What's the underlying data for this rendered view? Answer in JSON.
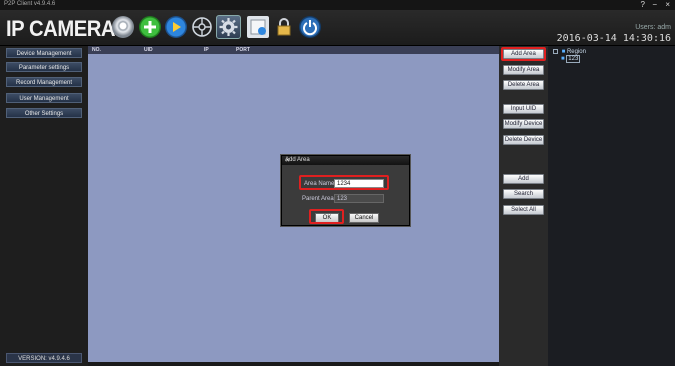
{
  "window": {
    "app_title": "P2P Client v4.9.4.6",
    "help": "?",
    "minimize": "−",
    "close": "×"
  },
  "header": {
    "logo": "IP CAMERA",
    "user_label": "Users: adm",
    "datetime": "2016-03-14 14:30:16",
    "toolbar": [
      {
        "name": "camera-view-icon",
        "color": "#dfe4ea"
      },
      {
        "name": "add-device-icon",
        "color": "#3fbf3f"
      },
      {
        "name": "playback-icon",
        "color": "#2e86de"
      },
      {
        "name": "ptz-icon",
        "color": "#cfd6de"
      },
      {
        "name": "settings-gear-icon",
        "color": "#d7dde6"
      },
      {
        "name": "log-icon",
        "color": "#cfd6de"
      },
      {
        "name": "lock-icon",
        "color": "#e6b84a"
      },
      {
        "name": "power-icon",
        "color": "#5aa0e6"
      }
    ]
  },
  "sidebar": {
    "items": [
      "Device Management",
      "Parameter settings",
      "Record Management",
      "User Management",
      "Other Settings"
    ],
    "version": "VERSION: v4.9.4.6"
  },
  "table": {
    "columns": [
      "NO.",
      "UID",
      "IP",
      "PORT"
    ]
  },
  "actions": [
    "Add Area",
    "Modify Area",
    "Delete Area",
    "Input UID",
    "Modify Device",
    "Delete Device",
    "Add",
    "Search",
    "Select All"
  ],
  "tree": {
    "root": "Region",
    "child": "123"
  },
  "dialog": {
    "title": "Add Area",
    "area_name_label": "Area Name:",
    "area_name_value": "1234",
    "parent_area_label": "Parent Area:",
    "parent_area_value": "123",
    "ok": "OK",
    "cancel": "Cancel"
  },
  "colors": {
    "highlight": "#e02020",
    "workspace": "#8d99c1",
    "nav_button": "#2f3e58"
  }
}
